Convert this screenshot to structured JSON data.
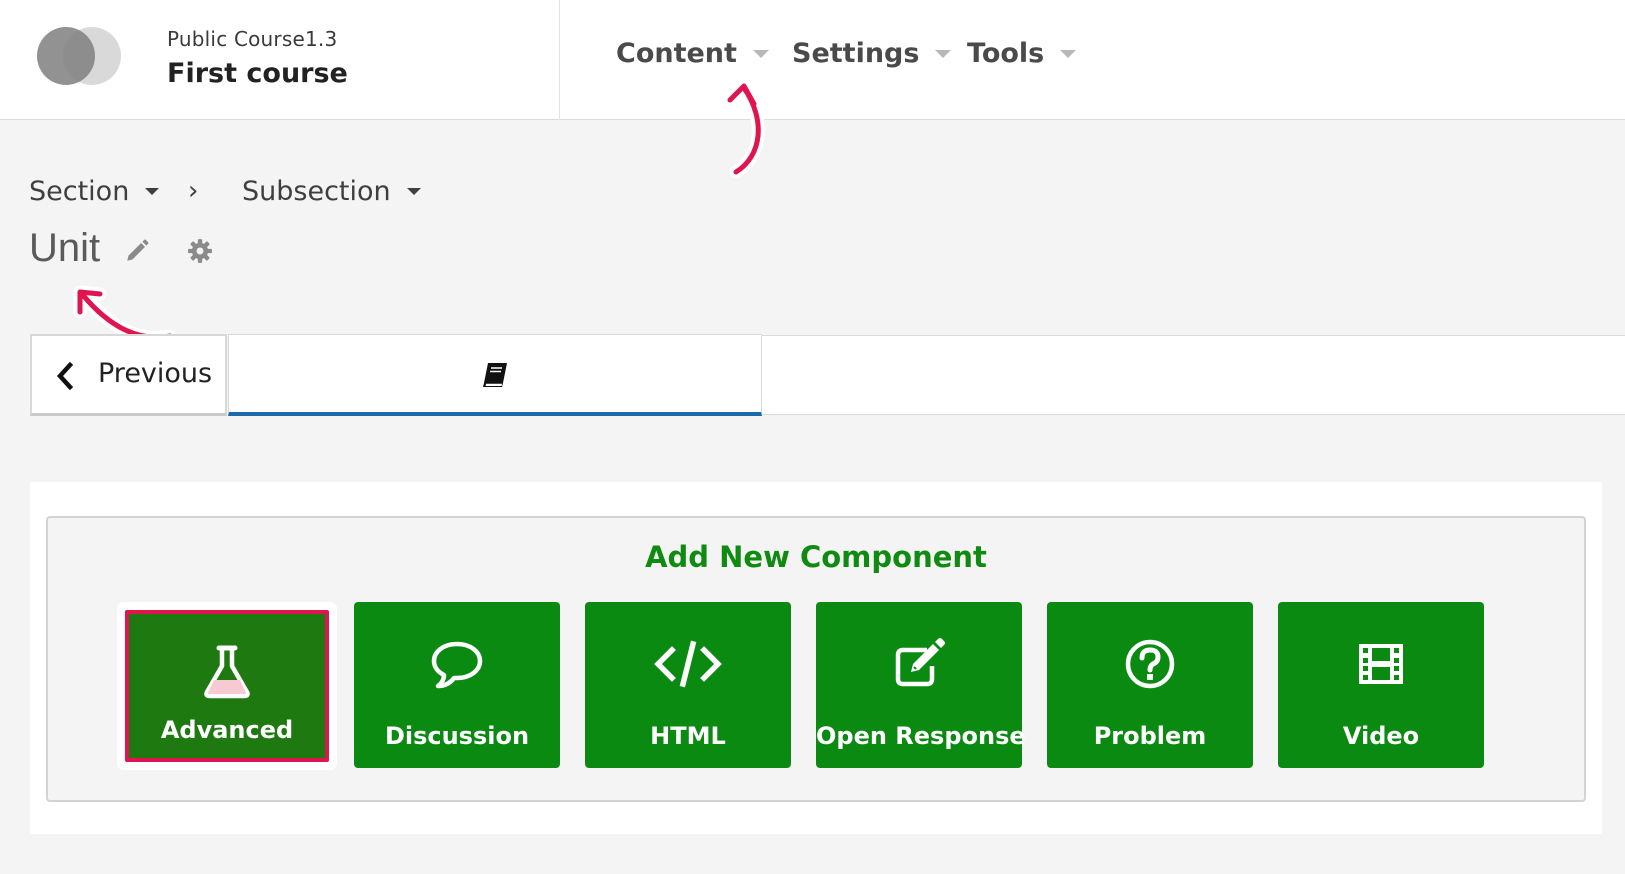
{
  "header": {
    "course_org": "Public Course1.3",
    "course_title": "First course",
    "nav": [
      {
        "label": "Content"
      },
      {
        "label": "Settings"
      },
      {
        "label": "Tools"
      }
    ]
  },
  "breadcrumb": {
    "section": "Section",
    "separator": "›",
    "subsection": "Subsection"
  },
  "unit": {
    "title": "Unit"
  },
  "sequence": {
    "previous_label": "Previous"
  },
  "add_component": {
    "heading": "Add New Component",
    "buttons": [
      {
        "label": "Advanced",
        "icon": "flask-icon",
        "selected": true
      },
      {
        "label": "Discussion",
        "icon": "speech-bubble-icon"
      },
      {
        "label": "HTML",
        "icon": "code-icon"
      },
      {
        "label": "Open Response",
        "icon": "edit-square-icon"
      },
      {
        "label": "Problem",
        "icon": "question-circle-icon"
      },
      {
        "label": "Video",
        "icon": "film-icon"
      }
    ]
  },
  "colors": {
    "accent_green": "#0b8a11",
    "selected_green": "#1e7a10",
    "highlight_pink": "#e0144f",
    "tab_underline_blue": "#1e6aa8"
  }
}
